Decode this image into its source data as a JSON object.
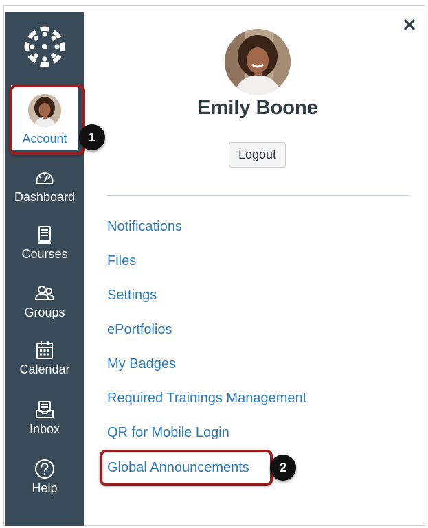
{
  "sidebar": {
    "logo_icon": "canvas-logo-icon",
    "account": {
      "label": "Account",
      "icon": "avatar"
    },
    "items": [
      {
        "label": "Dashboard",
        "icon": "dashboard-gauge-icon"
      },
      {
        "label": "Courses",
        "icon": "courses-book-icon"
      },
      {
        "label": "Groups",
        "icon": "groups-people-icon"
      },
      {
        "label": "Calendar",
        "icon": "calendar-icon"
      },
      {
        "label": "Inbox",
        "icon": "inbox-icon"
      },
      {
        "label": "Help",
        "icon": "help-question-icon"
      }
    ]
  },
  "tray": {
    "close_icon": "close-icon",
    "user_name": "Emily Boone",
    "logout_label": "Logout",
    "links": [
      "Notifications",
      "Files",
      "Settings",
      "ePortfolios",
      "My Badges",
      "Required Trainings Management",
      "QR for Mobile Login",
      "Global Announcements"
    ]
  },
  "callouts": [
    "1",
    "2"
  ],
  "colors": {
    "sidebar_bg": "#394b58",
    "link": "#2b7abc",
    "callout_border": "#9b1d20",
    "badge_bg": "#111111",
    "name_text": "#2d3b45"
  }
}
